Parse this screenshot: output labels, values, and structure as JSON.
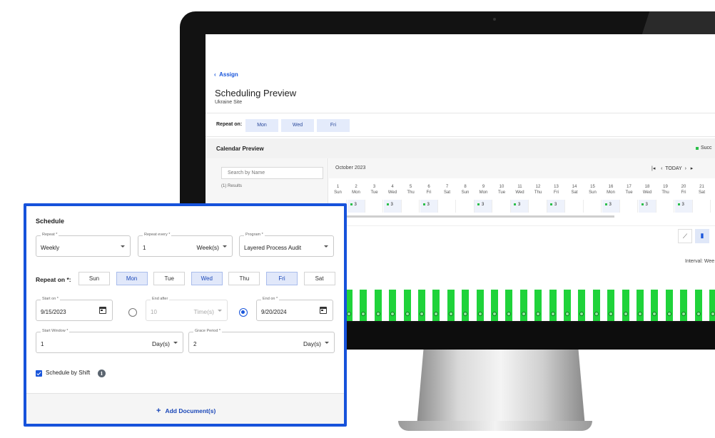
{
  "screen": {
    "back_link": "Assign",
    "title": "Scheduling Preview",
    "subtitle": "Ukraine Site",
    "repeat_on_label": "Repeat on:",
    "repeat_days": [
      "Mon",
      "Wed",
      "Fri"
    ],
    "calendar_title": "Calendar Preview",
    "legend_label": "Succ",
    "search_placeholder": "Search by Name",
    "results": "(1) Results",
    "month": "October 2023",
    "today_label": "TODAY",
    "days": [
      {
        "num": "1",
        "dow": "Sun",
        "count": ""
      },
      {
        "num": "2",
        "dow": "Mon",
        "count": "3"
      },
      {
        "num": "3",
        "dow": "Tue",
        "count": ""
      },
      {
        "num": "4",
        "dow": "Wed",
        "count": "3"
      },
      {
        "num": "5",
        "dow": "Thu",
        "count": ""
      },
      {
        "num": "6",
        "dow": "Fri",
        "count": "3"
      },
      {
        "num": "7",
        "dow": "Sat",
        "count": ""
      },
      {
        "num": "8",
        "dow": "Sun",
        "count": ""
      },
      {
        "num": "9",
        "dow": "Mon",
        "count": "3"
      },
      {
        "num": "10",
        "dow": "Tue",
        "count": ""
      },
      {
        "num": "11",
        "dow": "Wed",
        "count": "3"
      },
      {
        "num": "12",
        "dow": "Thu",
        "count": ""
      },
      {
        "num": "13",
        "dow": "Fri",
        "count": "3"
      },
      {
        "num": "14",
        "dow": "Sat",
        "count": ""
      },
      {
        "num": "15",
        "dow": "Sun",
        "count": ""
      },
      {
        "num": "16",
        "dow": "Mon",
        "count": "3"
      },
      {
        "num": "17",
        "dow": "Tue",
        "count": ""
      },
      {
        "num": "18",
        "dow": "Wed",
        "count": "3"
      },
      {
        "num": "19",
        "dow": "Thu",
        "count": ""
      },
      {
        "num": "20",
        "dow": "Fri",
        "count": "3"
      },
      {
        "num": "21",
        "dow": "Sat",
        "count": ""
      }
    ],
    "interval_label": "Interval: Wee",
    "green_bar_count": 26,
    "colors": {
      "accent": "#1a56db",
      "success": "#1fd33a"
    }
  },
  "schedule": {
    "title": "Schedule",
    "repeat": {
      "label": "Repeat *",
      "value": "Weekly"
    },
    "repeat_every": {
      "label": "Repeat every *",
      "value": "1",
      "unit": "Week(s)"
    },
    "program": {
      "label": "Program *",
      "value": "Layered Process Audit"
    },
    "repeat_on_label": "Repeat on *:",
    "weekdays": [
      {
        "label": "Sun",
        "selected": false
      },
      {
        "label": "Mon",
        "selected": true
      },
      {
        "label": "Tue",
        "selected": false
      },
      {
        "label": "Wed",
        "selected": true
      },
      {
        "label": "Thu",
        "selected": false
      },
      {
        "label": "Fri",
        "selected": true
      },
      {
        "label": "Sat",
        "selected": false
      }
    ],
    "start_on": {
      "label": "Start on *",
      "value": "9/15/2023"
    },
    "end_after": {
      "label": "End after",
      "value": "10",
      "unit": "Time(s)"
    },
    "end_on": {
      "label": "End on *",
      "value": "9/20/2024"
    },
    "start_window": {
      "label": "Start Window *",
      "value": "1",
      "unit": "Day(s)"
    },
    "grace_period": {
      "label": "Grace Period *",
      "value": "2",
      "unit": "Day(s)"
    },
    "schedule_by_shift": {
      "label": "Schedule by Shift",
      "checked": true
    },
    "add_document": "Add Document(s)",
    "border_color": "#1652db"
  }
}
